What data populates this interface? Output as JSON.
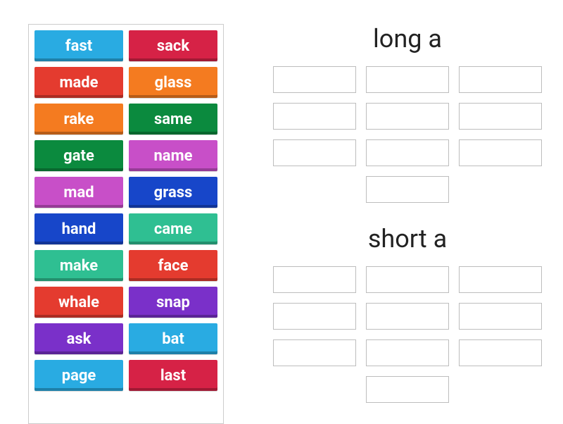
{
  "tiles": [
    {
      "label": "fast",
      "color": "c-lightblue"
    },
    {
      "label": "sack",
      "color": "c-crimson"
    },
    {
      "label": "made",
      "color": "c-red"
    },
    {
      "label": "glass",
      "color": "c-orange"
    },
    {
      "label": "rake",
      "color": "c-orange"
    },
    {
      "label": "same",
      "color": "c-darkgreen"
    },
    {
      "label": "gate",
      "color": "c-darkgreen"
    },
    {
      "label": "name",
      "color": "c-magenta"
    },
    {
      "label": "mad",
      "color": "c-magenta"
    },
    {
      "label": "grass",
      "color": "c-blue"
    },
    {
      "label": "hand",
      "color": "c-blue"
    },
    {
      "label": "came",
      "color": "c-teal"
    },
    {
      "label": "make",
      "color": "c-teal"
    },
    {
      "label": "face",
      "color": "c-red"
    },
    {
      "label": "whale",
      "color": "c-red"
    },
    {
      "label": "snap",
      "color": "c-purple"
    },
    {
      "label": "ask",
      "color": "c-purple"
    },
    {
      "label": "bat",
      "color": "c-lightblue"
    },
    {
      "label": "page",
      "color": "c-lightblue"
    },
    {
      "label": "last",
      "color": "c-crimson"
    }
  ],
  "categories": [
    {
      "title": "long a",
      "slot_count": 10
    },
    {
      "title": "short a",
      "slot_count": 10
    }
  ]
}
